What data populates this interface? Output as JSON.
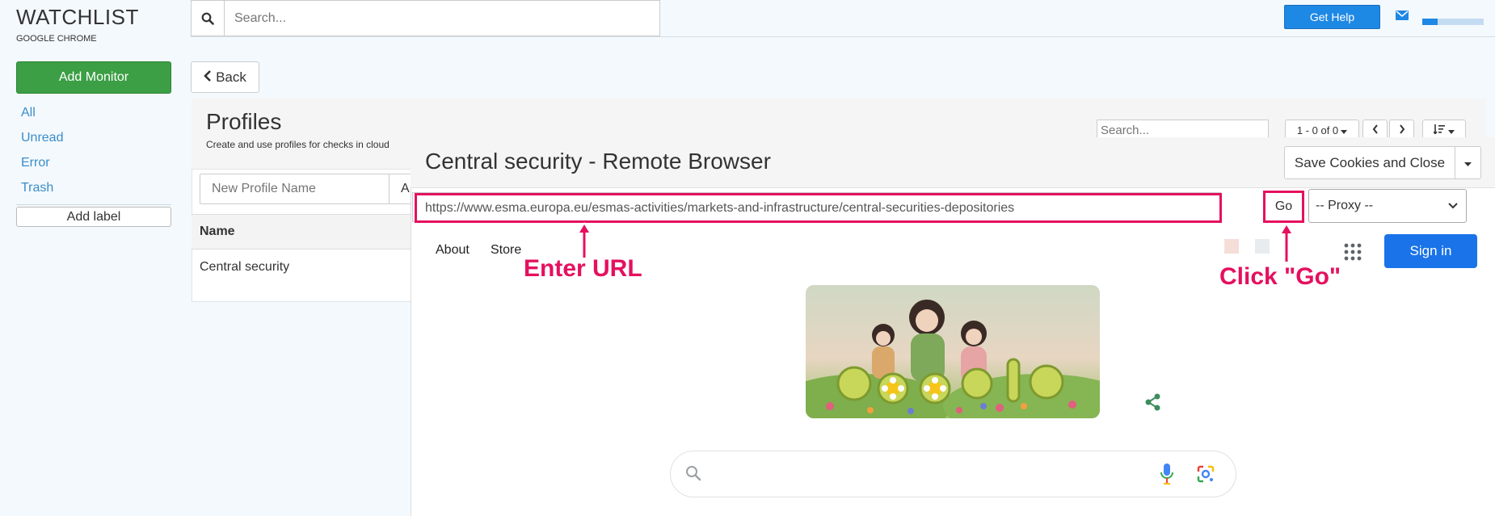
{
  "app": {
    "title": "WATCHLIST",
    "subtitle": "GOOGLE CHROME"
  },
  "sidebar": {
    "add_monitor": "Add Monitor",
    "links": [
      "All",
      "Unread",
      "Error",
      "Trash"
    ],
    "add_label": "Add label"
  },
  "topbar": {
    "search_placeholder": "Search...",
    "get_help": "Get Help",
    "progress_fraction": 0.25
  },
  "back_label": "Back",
  "profiles": {
    "title": "Profiles",
    "description": "Create and use profiles for checks in cloud",
    "table_search_placeholder": "Search...",
    "pager_text": "1 - 0 of 0",
    "new_profile_placeholder": "New Profile Name",
    "add_button_partial": "A",
    "columns": [
      "Name"
    ],
    "rows": [
      {
        "name": "Central security"
      }
    ]
  },
  "modal": {
    "title": "Central security - Remote Browser",
    "save_button": "Save Cookies and Close",
    "url": "https://www.esma.europa.eu/esmas-activities/markets-and-infrastructure/central-securities-depositories",
    "go_label": "Go",
    "proxy_selected": "-- Proxy --"
  },
  "remote_page": {
    "links": [
      "About",
      "Store"
    ],
    "sign_in": "Sign in"
  },
  "annotations": {
    "enter_url": "Enter URL",
    "click_go": "Click \"Go\"",
    "color": "#e5105f"
  },
  "colors": {
    "primary": "#1e88e5",
    "success": "#3c9e45",
    "link": "#3a8dc8",
    "google_blue": "#1a73e8"
  }
}
